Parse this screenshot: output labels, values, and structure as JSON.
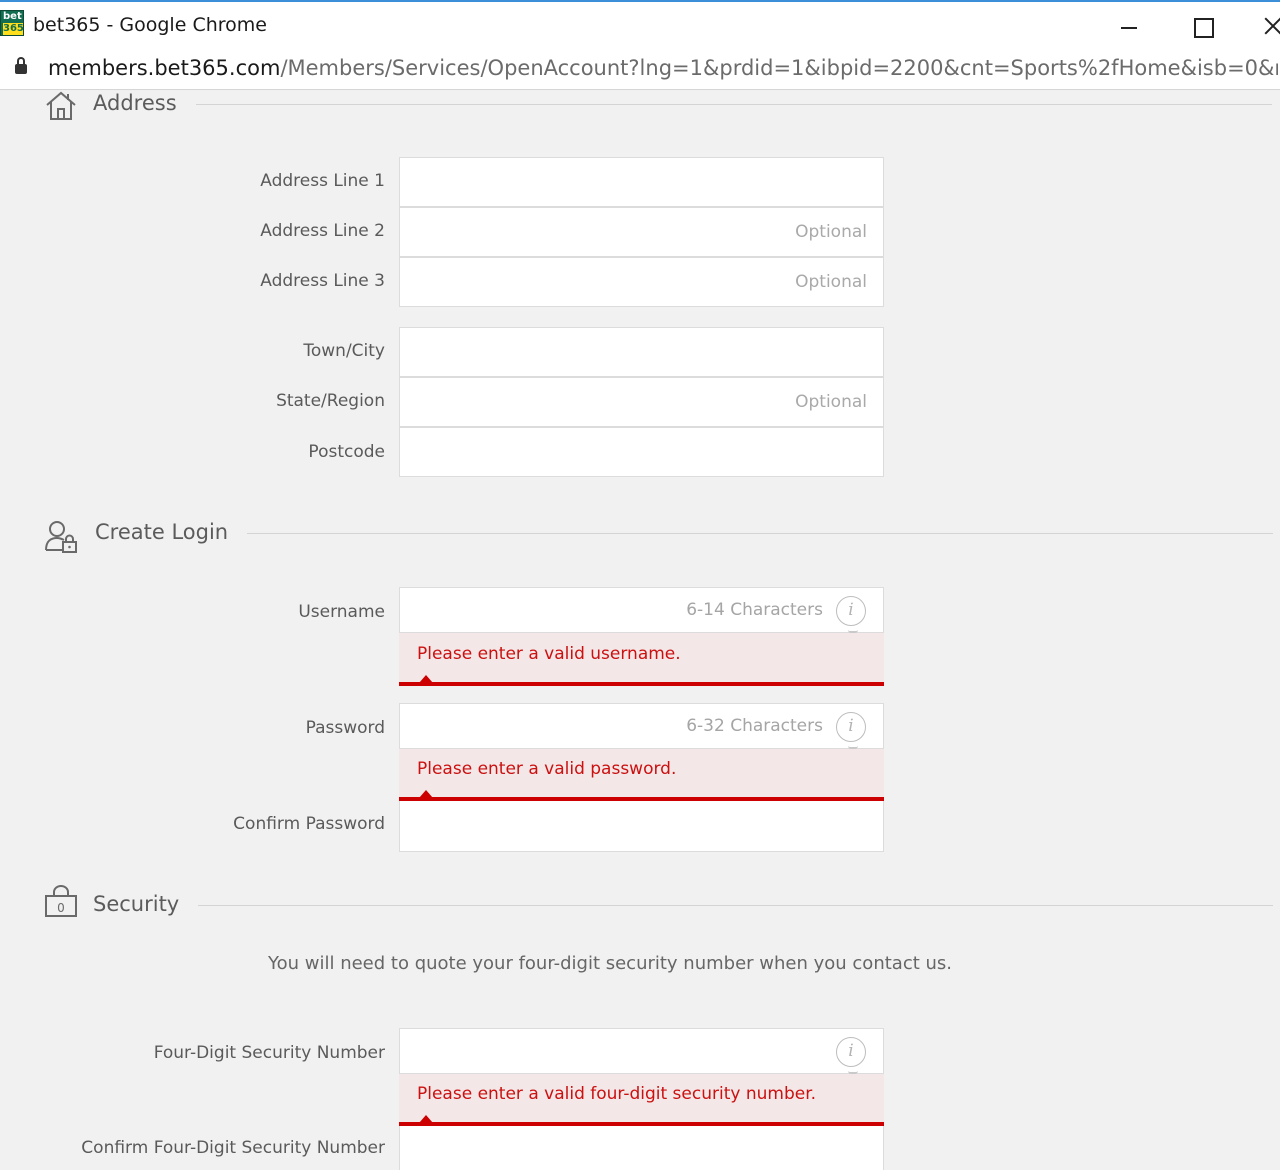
{
  "window": {
    "logo_top": "bet",
    "logo_bottom": "365",
    "title": "bet365 - Google Chrome"
  },
  "address_bar": {
    "host": "members.bet365.com",
    "path": "/Members/Services/OpenAccount?lng=1&prdid=1&ibpid=2200&cnt=Sports%2fHome&isb=0&rurl..."
  },
  "address": {
    "title": "Address",
    "line1_label": "Address Line 1",
    "line2_label": "Address Line 2",
    "line2_placeholder": "Optional",
    "line3_label": "Address Line 3",
    "line3_placeholder": "Optional",
    "town_label": "Town/City",
    "state_label": "State/Region",
    "state_placeholder": "Optional",
    "postcode_label": "Postcode"
  },
  "login": {
    "title": "Create Login",
    "username_label": "Username",
    "username_hint": "6-14 Characters",
    "username_error": "Please enter a valid username.",
    "password_label": "Password",
    "password_hint": "6-32 Characters",
    "password_error": "Please enter a valid password.",
    "confirm_password_label": "Confirm Password"
  },
  "security": {
    "title": "Security",
    "lock_digit": "0",
    "note": "You will need to quote your four-digit security number when you contact us.",
    "number_label": "Four-Digit Security Number",
    "number_error": "Please enter a valid four-digit security number.",
    "confirm_label": "Confirm Four-Digit Security Number"
  },
  "info_glyph": "i",
  "colors": {
    "error": "#cc0000",
    "error_bg": "#f3e7e7",
    "page_bg": "#f1f1f1",
    "brand_green": "#126e51",
    "brand_yellow": "#ffdf1b"
  }
}
